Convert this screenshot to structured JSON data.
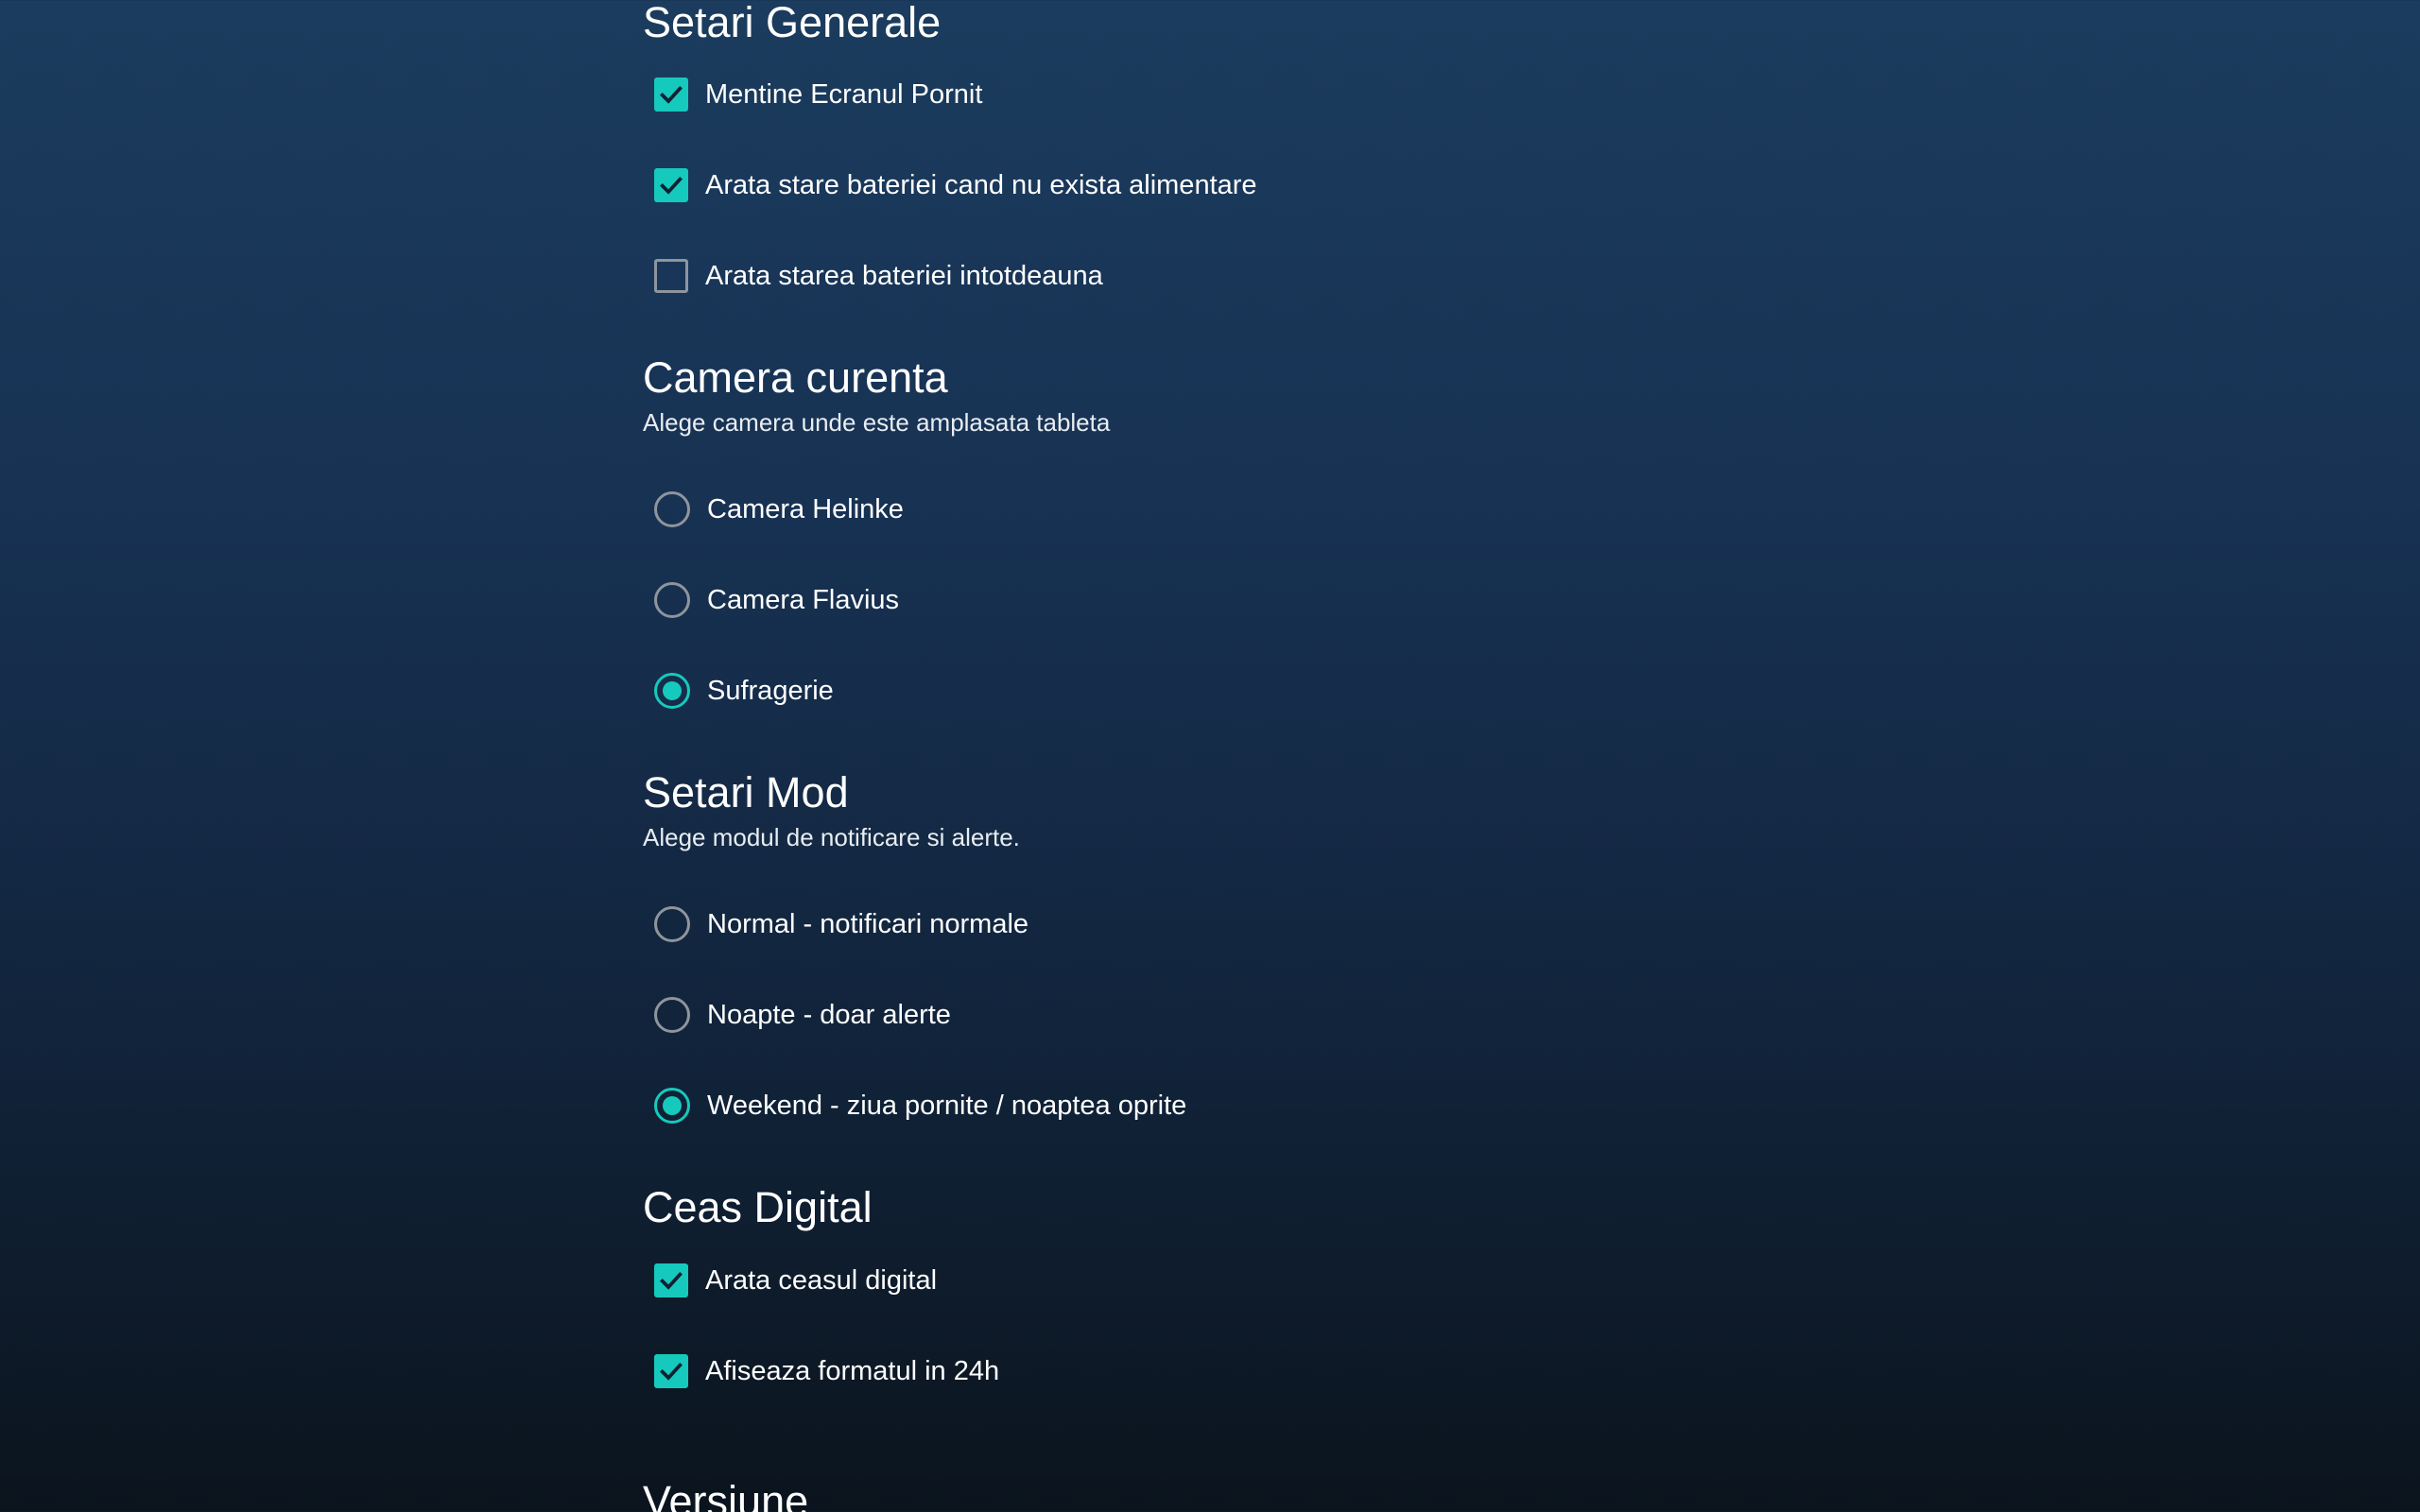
{
  "accent_color": "#16c9bd",
  "sections": {
    "general": {
      "title": "Setari Generale",
      "items": [
        {
          "label": "Mentine Ecranul Pornit",
          "checked": true,
          "icon": "checkmark-icon"
        },
        {
          "label": "Arata stare bateriei cand nu exista alimentare",
          "checked": true,
          "icon": "checkmark-icon"
        },
        {
          "label": "Arata starea bateriei intotdeauna",
          "checked": false
        }
      ]
    },
    "room": {
      "title": "Camera curenta",
      "subtitle": "Alege camera unde este amplasata tableta",
      "options": [
        {
          "label": "Camera Helinke",
          "selected": false
        },
        {
          "label": "Camera Flavius",
          "selected": false
        },
        {
          "label": "Sufragerie",
          "selected": true
        }
      ]
    },
    "mode": {
      "title": "Setari Mod",
      "subtitle": "Alege modul de notificare si alerte.",
      "options": [
        {
          "label": "Normal - notificari normale",
          "selected": false
        },
        {
          "label": "Noapte - doar alerte",
          "selected": false
        },
        {
          "label": "Weekend - ziua pornite / noaptea oprite",
          "selected": true
        }
      ]
    },
    "clock": {
      "title": "Ceas Digital",
      "items": [
        {
          "label": "Arata ceasul digital",
          "checked": true,
          "icon": "checkmark-icon"
        },
        {
          "label": "Afiseaza formatul in 24h",
          "checked": true,
          "icon": "checkmark-icon"
        }
      ]
    },
    "version": {
      "title": "Versiune"
    }
  }
}
